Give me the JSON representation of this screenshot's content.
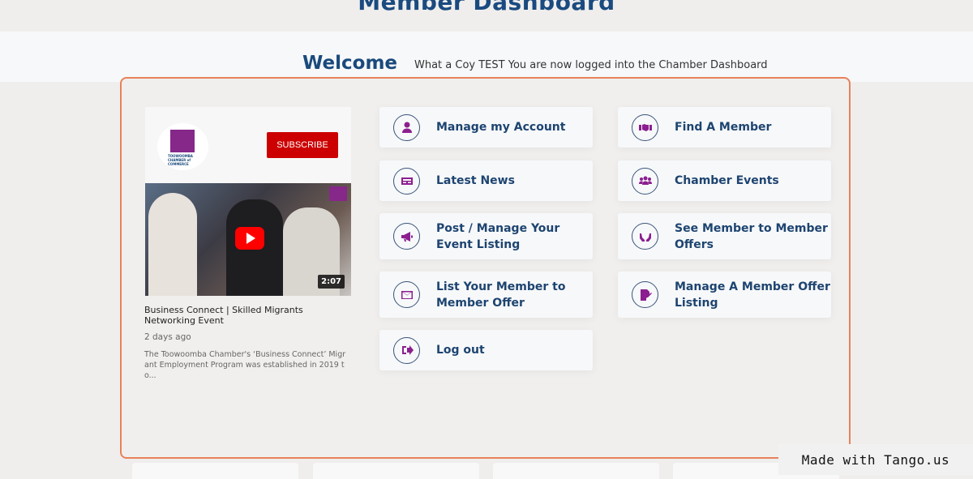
{
  "header": {
    "page_title": "Member Dashboard",
    "welcome_title": "Welcome",
    "welcome_message": "What a Coy TEST You are now logged into the Chamber Dashboard"
  },
  "video": {
    "channel_logo_text": "TOOWOOMBA CHAMBER of COMMERCE",
    "subscribe_label": "SUBSCRIBE",
    "duration": "2:07",
    "title": "Business Connect | Skilled Migrants Networking Event",
    "age": "2 days ago",
    "description": "The Toowoomba Chamber's ‘Business Connect’ Migrant Employment Program was established in 2019 to..."
  },
  "menu": {
    "left": [
      {
        "label": "Manage my Account",
        "icon": "user-icon"
      },
      {
        "label": "Latest News",
        "icon": "newspaper-icon"
      },
      {
        "label": "Post / Manage Your Event Listing",
        "icon": "megaphone-icon"
      },
      {
        "label": "List Your Member to Member Offer",
        "icon": "envelope-icon"
      },
      {
        "label": "Log out",
        "icon": "sign-out-icon"
      }
    ],
    "right": [
      {
        "label": "Find A Member",
        "icon": "handshake-icon"
      },
      {
        "label": "Chamber Events",
        "icon": "users-icon"
      },
      {
        "label": "See Member to Member Offers",
        "icon": "hands-icon"
      },
      {
        "label": "Manage A Member Offer Listing",
        "icon": "file-signature-icon"
      }
    ]
  },
  "watermark": "Made with Tango.us",
  "colors": {
    "accent_border": "#e8825a",
    "heading_blue": "#1a4a7c",
    "icon_purple": "#8b1f8f",
    "subscribe_red": "#cc0000"
  }
}
